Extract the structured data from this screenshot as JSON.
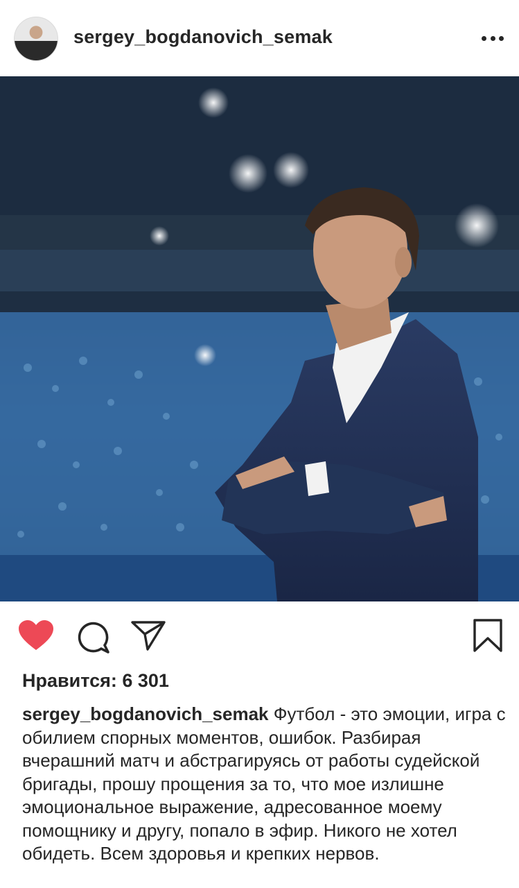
{
  "post": {
    "username": "sergey_bogdanovich_semak",
    "likes_text": "Нравится: 6 301",
    "caption_author": "sergey_bogdanovich_semak",
    "caption_text": "Футбол - это эмоции, игра с обилием спорных моментов, ошибок. Разбирая вчерашний матч и абстрагируясь от работы судейской бригады, прошу прощения за то, что мое излишне эмоциональное выражение, адресованное  моему помощнику и другу, попало в эфир. Никого не хотел обидеть. Всем здоровья и крепких нервов."
  },
  "icons": {
    "like": "heart-icon",
    "comment": "comment-icon",
    "share": "paper-plane-icon",
    "save": "bookmark-icon",
    "more": "ellipsis-icon"
  },
  "colors": {
    "like_active": "#ed4956",
    "text": "#262626"
  }
}
